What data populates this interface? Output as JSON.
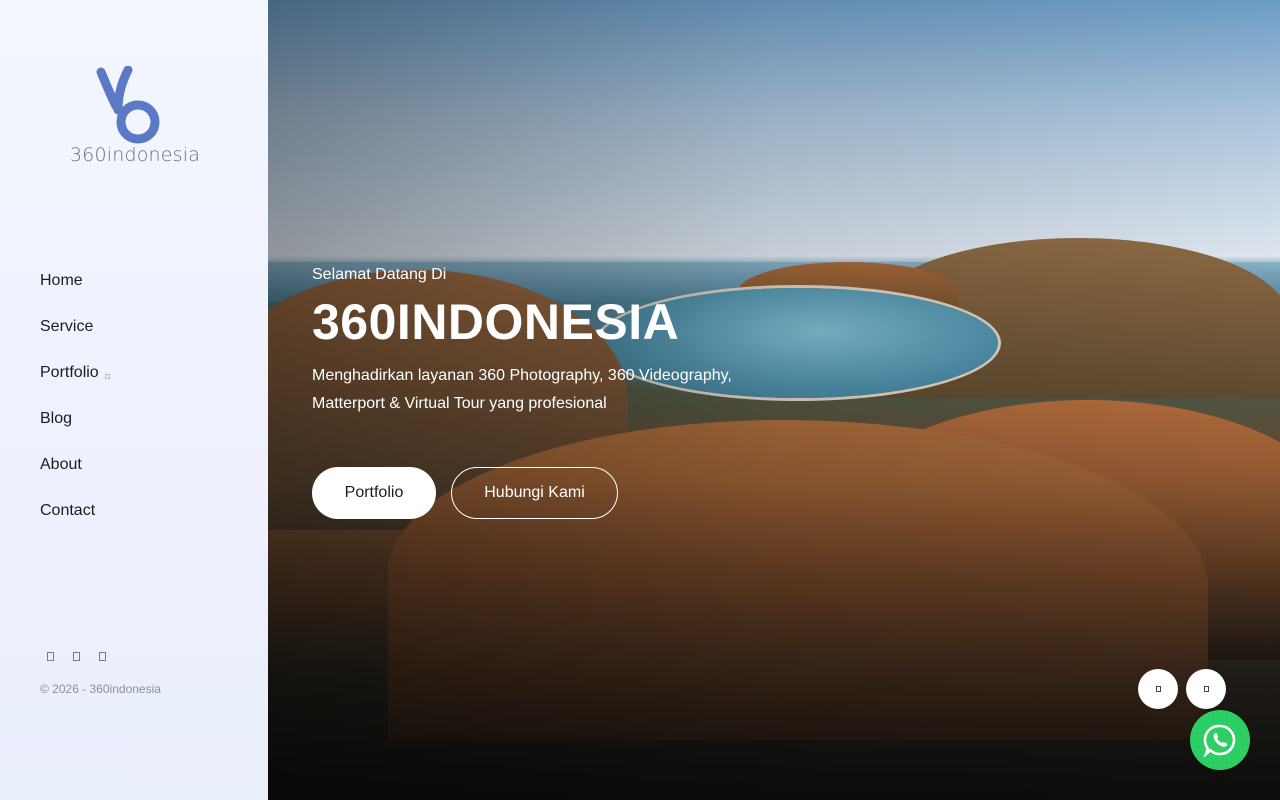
{
  "brand": {
    "name": "360indonesia",
    "accent": "#5b79c4"
  },
  "nav": {
    "items": [
      {
        "label": "Home"
      },
      {
        "label": "Service"
      },
      {
        "label": "Portfolio",
        "has_submenu": true
      },
      {
        "label": "Blog"
      },
      {
        "label": "About"
      },
      {
        "label": "Contact"
      }
    ]
  },
  "social": {
    "icons": [
      "facebook-icon",
      "instagram-icon",
      "youtube-icon"
    ]
  },
  "footer": {
    "copyright": "© 2026 - 360indonesia"
  },
  "hero": {
    "kicker": "Selamat Datang Di",
    "title": "360INDONESIA",
    "description": "Menghadirkan layanan 360 Photography, 360 Videography, Matterport & Virtual Tour yang profesional",
    "primary_button": "Portfolio",
    "secondary_button": "Hubungi Kami"
  },
  "floating": {
    "icons": [
      "share-icon",
      "chat-icon"
    ],
    "whatsapp_color": "#2ccf63"
  }
}
